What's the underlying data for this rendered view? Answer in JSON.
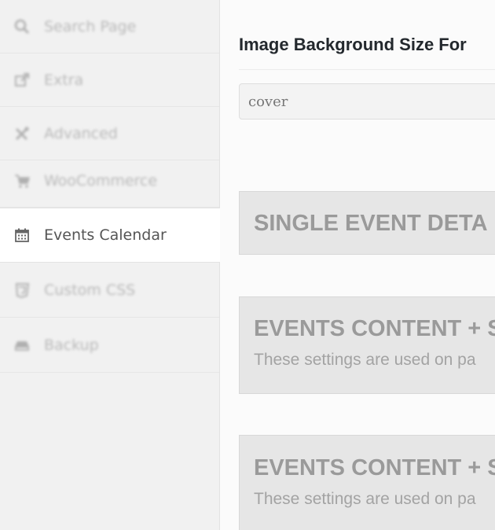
{
  "sidebar": {
    "items": [
      {
        "label": "Search Page",
        "icon": "search-icon"
      },
      {
        "label": "Extra",
        "icon": "external-link-icon"
      },
      {
        "label": "Advanced",
        "icon": "tools-icon"
      },
      {
        "label": "WooCommerce",
        "icon": "cart-icon"
      },
      {
        "label": "Events Calendar",
        "icon": "calendar-icon",
        "active": true
      },
      {
        "label": "Custom CSS",
        "icon": "css3-icon"
      },
      {
        "label": "Backup",
        "icon": "drive-icon"
      }
    ]
  },
  "main": {
    "field_title": "Image Background Size For",
    "select_value": "cover",
    "sections": [
      {
        "title": "SINGLE EVENT DETA",
        "description": ""
      },
      {
        "title": "EVENTS CONTENT + S",
        "description": "These settings are used on pa"
      },
      {
        "title": "EVENTS CONTENT + S",
        "description": "These settings are used on pa"
      }
    ]
  },
  "colors": {
    "sidebar_bg": "#f1f1f1",
    "active_item_bg": "#ffffff",
    "section_bg": "#e6e6e6",
    "section_text": "#9a9a9a"
  }
}
